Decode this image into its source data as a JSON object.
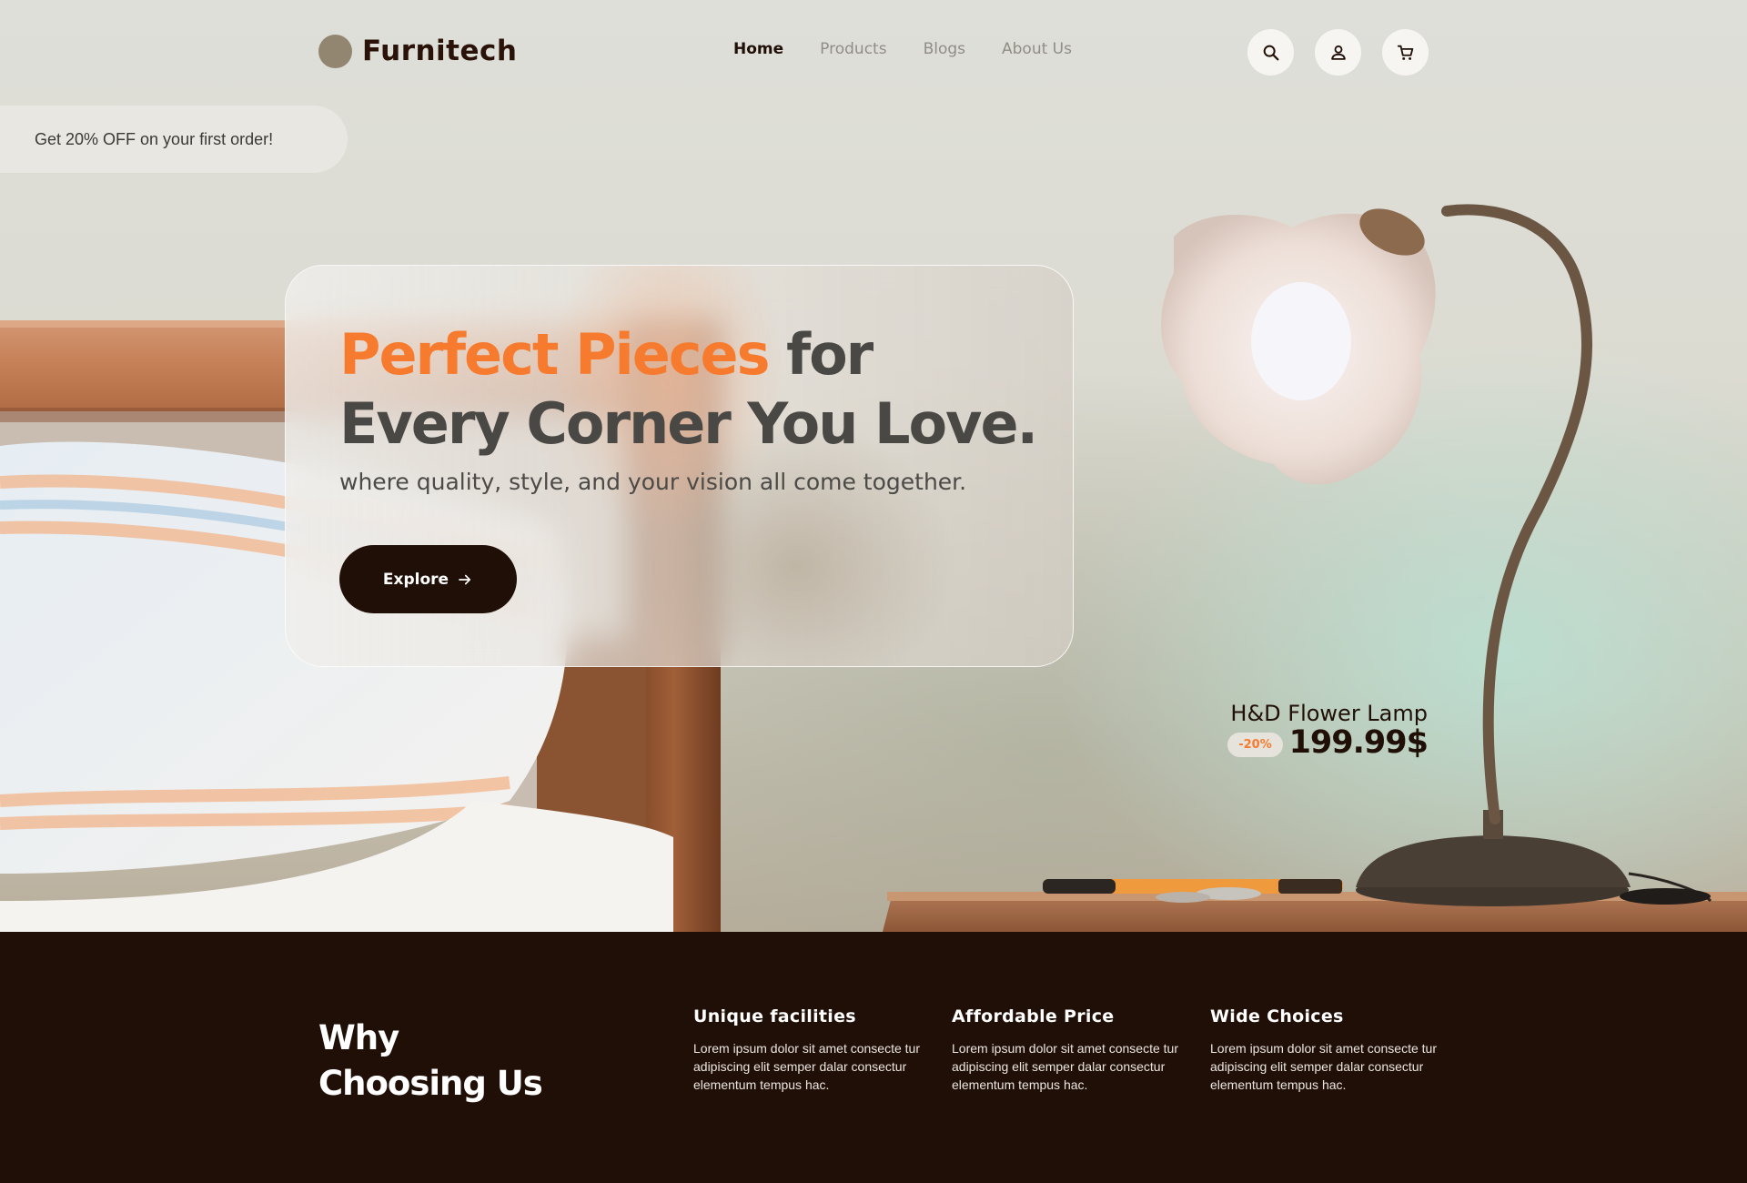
{
  "brand": {
    "name": "Furnitech"
  },
  "nav": {
    "items": [
      {
        "label": "Home"
      },
      {
        "label": "Products"
      },
      {
        "label": "Blogs"
      },
      {
        "label": "About Us"
      }
    ],
    "active": "Home",
    "icons": [
      "search-icon",
      "user-icon",
      "cart-icon"
    ]
  },
  "promo": {
    "text": "Get 20% OFF on your first order!"
  },
  "hero": {
    "headline_accent": "Perfect Pieces",
    "headline_rest_1": " for",
    "headline_line2": "Every Corner You Love.",
    "subline": "where quality, style, and your vision all come together.",
    "cta_label": "Explore"
  },
  "product": {
    "name": "H&D Flower Lamp",
    "discount": "-20%",
    "price": "199.99$"
  },
  "why": {
    "title_line1": "Why",
    "title_line2": "Choosing Us",
    "features": [
      {
        "title": "Unique facilities",
        "text": "Lorem ipsum dolor sit amet consecte tur adipiscing elit semper dalar consectur elementum tempus hac."
      },
      {
        "title": "Affordable Price",
        "text": "Lorem ipsum dolor sit amet consecte tur adipiscing elit semper dalar consectur elementum tempus hac."
      },
      {
        "title": "Wide Choices",
        "text": "Lorem ipsum dolor sit amet consecte tur adipiscing elit semper dalar consectur elementum tempus hac."
      }
    ]
  },
  "colors": {
    "accent": "#f77b2e",
    "dark": "#200f06",
    "logo_dot": "#938671"
  }
}
